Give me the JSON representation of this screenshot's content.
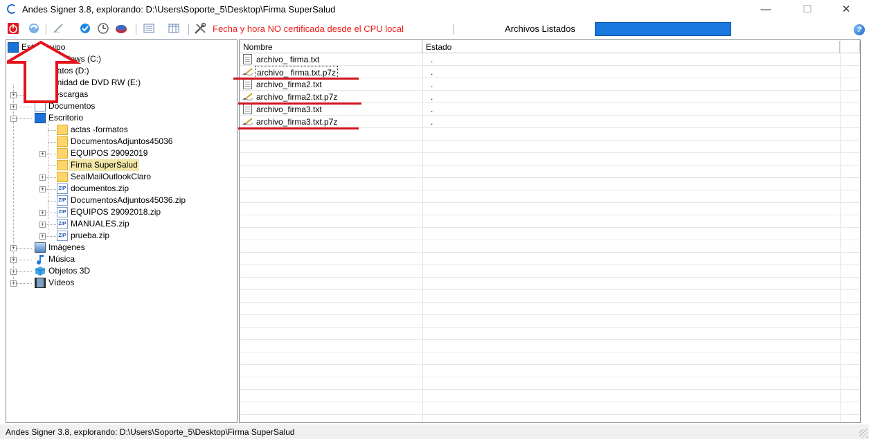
{
  "window": {
    "title": "Andes Signer 3.8, explorando: D:\\Users\\Soporte_5\\Desktop\\Firma SuperSalud",
    "controls": {
      "minimize": "—",
      "maximize": "☐",
      "close": "✕"
    }
  },
  "toolbar": {
    "certification_message": "Fecha y hora NO certificada desde el CPU local",
    "files_listed_label": "Archivos Listados",
    "help": "?",
    "colors": {
      "warning": "#e81c1c",
      "progress": "#1878dd"
    }
  },
  "tree": {
    "items": [
      {
        "label": "Este equipo",
        "kind": "computer"
      },
      {
        "label": "Windows (C:)",
        "kind": "drive"
      },
      {
        "label": "Datos (D:)",
        "kind": "drive"
      },
      {
        "label": "Unidad de DVD RW (E:)",
        "kind": "dvd"
      },
      {
        "label": "Descargas",
        "kind": "download"
      },
      {
        "label": "Documentos",
        "kind": "documents"
      },
      {
        "label": "Escritorio",
        "kind": "desktop"
      },
      {
        "label": "actas -formatos",
        "kind": "folder"
      },
      {
        "label": "DocumentosAdjuntos45036",
        "kind": "folder"
      },
      {
        "label": "EQUIPOS 29092019",
        "kind": "folder"
      },
      {
        "label": "Firma SuperSalud",
        "kind": "folder",
        "selected": true
      },
      {
        "label": "SealMailOutlookClaro",
        "kind": "folder"
      },
      {
        "label": "documentos.zip",
        "kind": "zip",
        "zip_label": "ZIP"
      },
      {
        "label": "DocumentosAdjuntos45036.zip",
        "kind": "zip",
        "zip_label": "ZIP"
      },
      {
        "label": "EQUIPOS 29092018.zip",
        "kind": "zip",
        "zip_label": "ZIP"
      },
      {
        "label": "MANUALES.zip",
        "kind": "zip",
        "zip_label": "ZIP"
      },
      {
        "label": "prueba.zip",
        "kind": "zip",
        "zip_label": "ZIP"
      },
      {
        "label": "Imágenes",
        "kind": "pictures"
      },
      {
        "label": "Música",
        "kind": "music"
      },
      {
        "label": "Objetos 3D",
        "kind": "objects3d"
      },
      {
        "label": "Vídeos",
        "kind": "videos"
      }
    ]
  },
  "file_list": {
    "columns": [
      "Nombre",
      "Estado"
    ],
    "rows": [
      {
        "name": "archivo_ firma.txt",
        "state": ".",
        "type": "txt"
      },
      {
        "name": "archivo_ firma.txt.p7z",
        "state": ".",
        "type": "signed"
      },
      {
        "name": "archivo_firma2.txt",
        "state": ".",
        "type": "txt"
      },
      {
        "name": "archivo_firma2.txt.p7z",
        "state": ".",
        "type": "signed"
      },
      {
        "name": "archivo_firma3.txt",
        "state": ".",
        "type": "txt"
      },
      {
        "name": "archivo_firma3.txt.p7z",
        "state": ".",
        "type": "signed"
      }
    ]
  },
  "status_bar": {
    "text": "Andes Signer 3.8, explorando: D:\\Users\\Soporte_5\\Desktop\\Firma SuperSalud"
  }
}
